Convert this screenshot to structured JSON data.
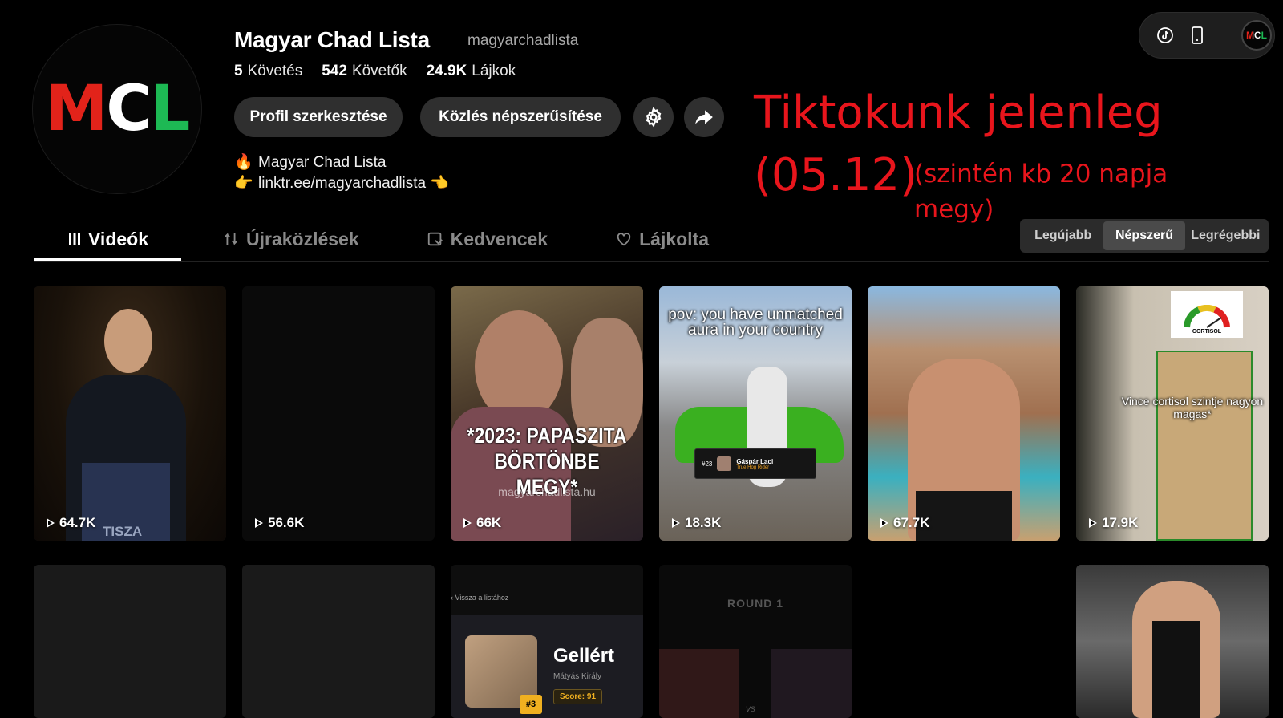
{
  "profile": {
    "avatar_letters": [
      "M",
      "C",
      "L"
    ],
    "username": "Magyar Chad Lista",
    "handle": "magyarchadlista",
    "stats": [
      {
        "num": "5",
        "label": "Követés"
      },
      {
        "num": "542",
        "label": "Követők"
      },
      {
        "num": "24.9K",
        "label": "Lájkok"
      }
    ],
    "edit_label": "Profil szerkesztése",
    "promote_label": "Közlés népszerűsítése",
    "bio_line1": "Magyar Chad Lista",
    "bio_line2": "linktr.ee/magyarchadlista"
  },
  "annotation": {
    "line1": "Tiktokunk jelenleg",
    "line2": "(05.12)",
    "note": "(szintén kb 20 napja megy)"
  },
  "topbar": {
    "mini_avatar": "MCL"
  },
  "tabs": [
    {
      "label": "Videók",
      "icon": "grid-icon"
    },
    {
      "label": "Újraközlések",
      "icon": "repost-icon"
    },
    {
      "label": "Kedvencek",
      "icon": "bookmark-icon"
    },
    {
      "label": "Lájkolta",
      "icon": "heart-icon"
    }
  ],
  "sort": [
    "Legújabb",
    "Népszerű",
    "Legrégebbi"
  ],
  "videos_row1": [
    {
      "views": "64.7K",
      "watermark": "TISZA"
    },
    {
      "views": "56.6K"
    },
    {
      "views": "66K",
      "caption": "*2023: PAPASZITA BÖRTÖNBE MEGY*",
      "site": "magyarchadlista.hu"
    },
    {
      "views": "18.3K",
      "caption": "pov: you have unmatched aura in your country",
      "rank": "#23",
      "name": "Gáspár Laci",
      "subtitle": "True Hog Rider"
    },
    {
      "views": "67.7K"
    },
    {
      "views": "17.9K",
      "caption": "Vince cortisol szintje nagyon magas*",
      "badge": "CORTISOL"
    }
  ],
  "videos_row2": [
    {},
    {},
    {
      "back": "‹ Vissza a listához",
      "name": "Gellért",
      "sub": "Mátyás Király",
      "score": "Score: 91",
      "rank": "#3"
    },
    {
      "round": "ROUND 1",
      "vs": "vs"
    },
    {},
    {}
  ],
  "colors": {
    "red": "#e2231a",
    "green": "#1db954",
    "annotation": "#e8151c"
  }
}
